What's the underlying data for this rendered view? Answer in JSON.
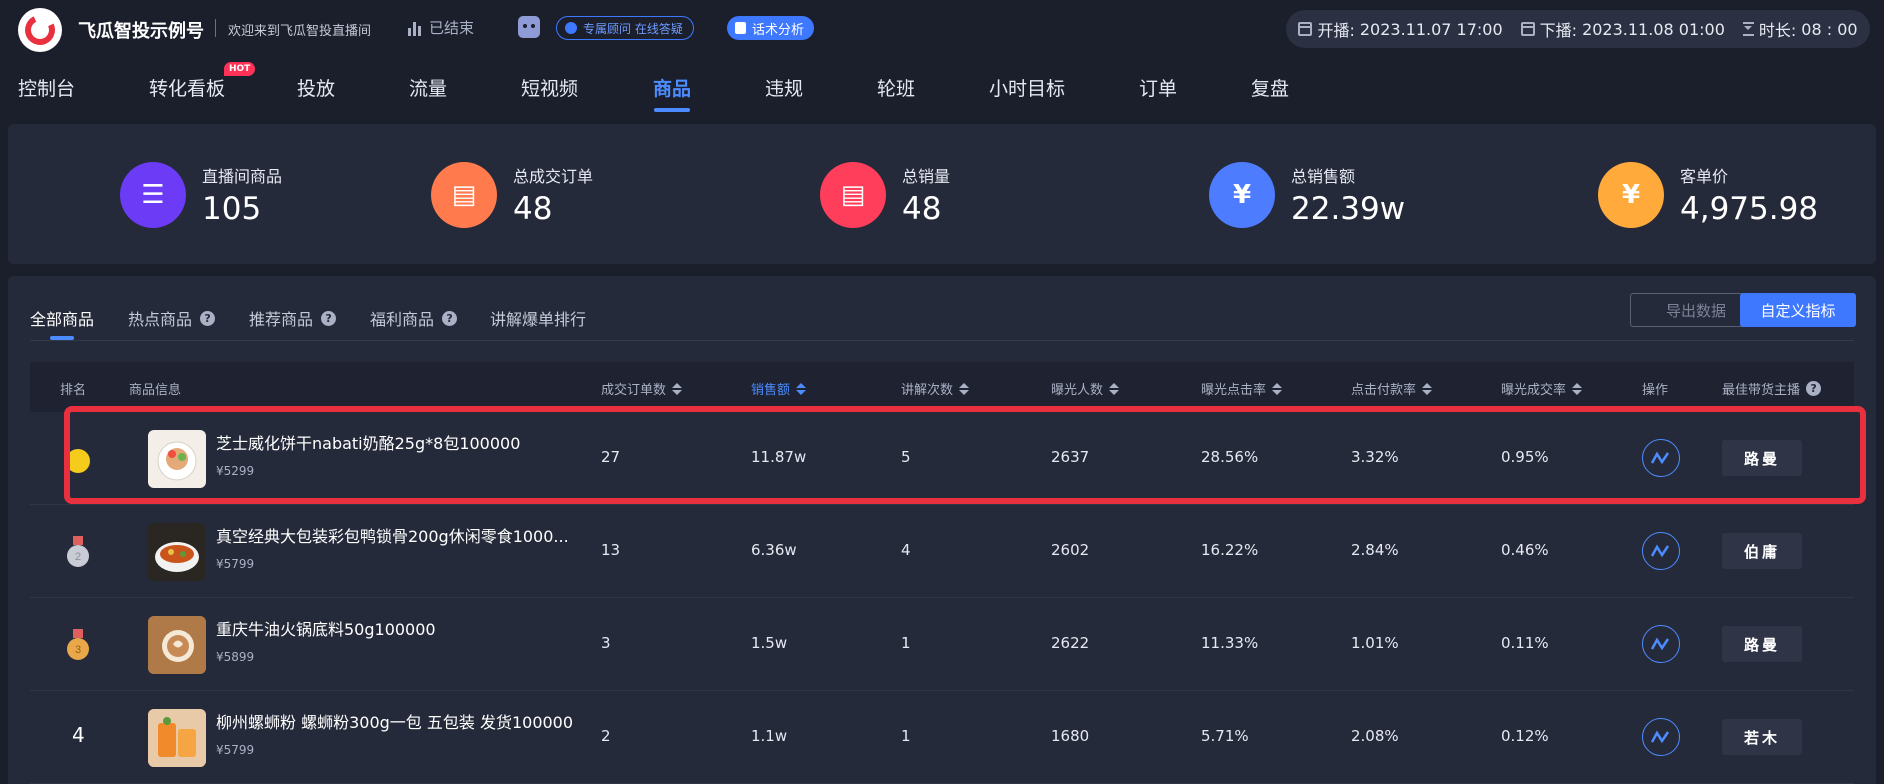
{
  "header": {
    "app_title": "飞瓜智投示例号",
    "welcome": "欢迎来到飞瓜智投直播间",
    "status": "已结束",
    "consult_label": "专属顾问 在线答疑",
    "script_analysis_label": "话术分析",
    "start_label": "开播:",
    "start_time": "2023.11.07 17:00",
    "end_label": "下播:",
    "end_time": "2023.11.08 01:00",
    "duration_label": "时长:",
    "duration": "08 : 00"
  },
  "nav": {
    "items": [
      "控制台",
      "转化看板",
      "投放",
      "流量",
      "短视频",
      "商品",
      "违规",
      "轮班",
      "小时目标",
      "订单",
      "复盘"
    ],
    "active": "商品",
    "hot_badge": "HOT"
  },
  "stats": [
    {
      "label": "直播间商品",
      "value": "105",
      "icon": "layers-icon",
      "color": "#6c3bf5"
    },
    {
      "label": "总成交订单",
      "value": "48",
      "icon": "order-doc-icon",
      "color": "#ff7a4d"
    },
    {
      "label": "总销量",
      "value": "48",
      "icon": "sales-doc-icon",
      "color": "#ff3e5b"
    },
    {
      "label": "总销售额",
      "value": "22.39w",
      "icon": "yen-icon",
      "color": "#4d7cff"
    },
    {
      "label": "客单价",
      "value": "4,975.98",
      "icon": "price-tag-icon",
      "color": "#ffaa3b"
    }
  ],
  "products": {
    "tabs": [
      "全部商品",
      "热点商品",
      "推荐商品",
      "福利商品",
      "讲解爆单排行"
    ],
    "export_label": "导出数据",
    "custom_label": "自定义指标",
    "columns": [
      "排名",
      "商品信息",
      "成交订单数",
      "销售额",
      "讲解次数",
      "曝光人数",
      "曝光点击率",
      "点击付款率",
      "曝光成交率",
      "操作",
      "最佳带货主播"
    ],
    "rows": [
      {
        "rank": "1",
        "name": "芝士威化饼干nabati奶酪25g*8包100000",
        "price": "¥5299",
        "orders": "27",
        "sales": "11.87w",
        "explains": "5",
        "exposure": "2637",
        "ctr": "28.56%",
        "pay_rate": "3.32%",
        "conv": "0.95%",
        "host": "路曼"
      },
      {
        "rank": "2",
        "name": "真空经典大包装彩包鸭锁骨200g休闲零食1000...",
        "price": "¥5799",
        "orders": "13",
        "sales": "6.36w",
        "explains": "4",
        "exposure": "2602",
        "ctr": "16.22%",
        "pay_rate": "2.84%",
        "conv": "0.46%",
        "host": "伯庸"
      },
      {
        "rank": "3",
        "name": "重庆牛油火锅底料50g100000",
        "price": "¥5899",
        "orders": "3",
        "sales": "1.5w",
        "explains": "1",
        "exposure": "2622",
        "ctr": "11.33%",
        "pay_rate": "1.01%",
        "conv": "0.11%",
        "host": "路曼"
      },
      {
        "rank": "4",
        "name": "柳州螺蛳粉 螺蛳粉300g一包 五包装 发货100000",
        "price": "¥5799",
        "orders": "2",
        "sales": "1.1w",
        "explains": "1",
        "exposure": "1680",
        "ctr": "5.71%",
        "pay_rate": "2.08%",
        "conv": "0.12%",
        "host": "若木"
      }
    ]
  }
}
